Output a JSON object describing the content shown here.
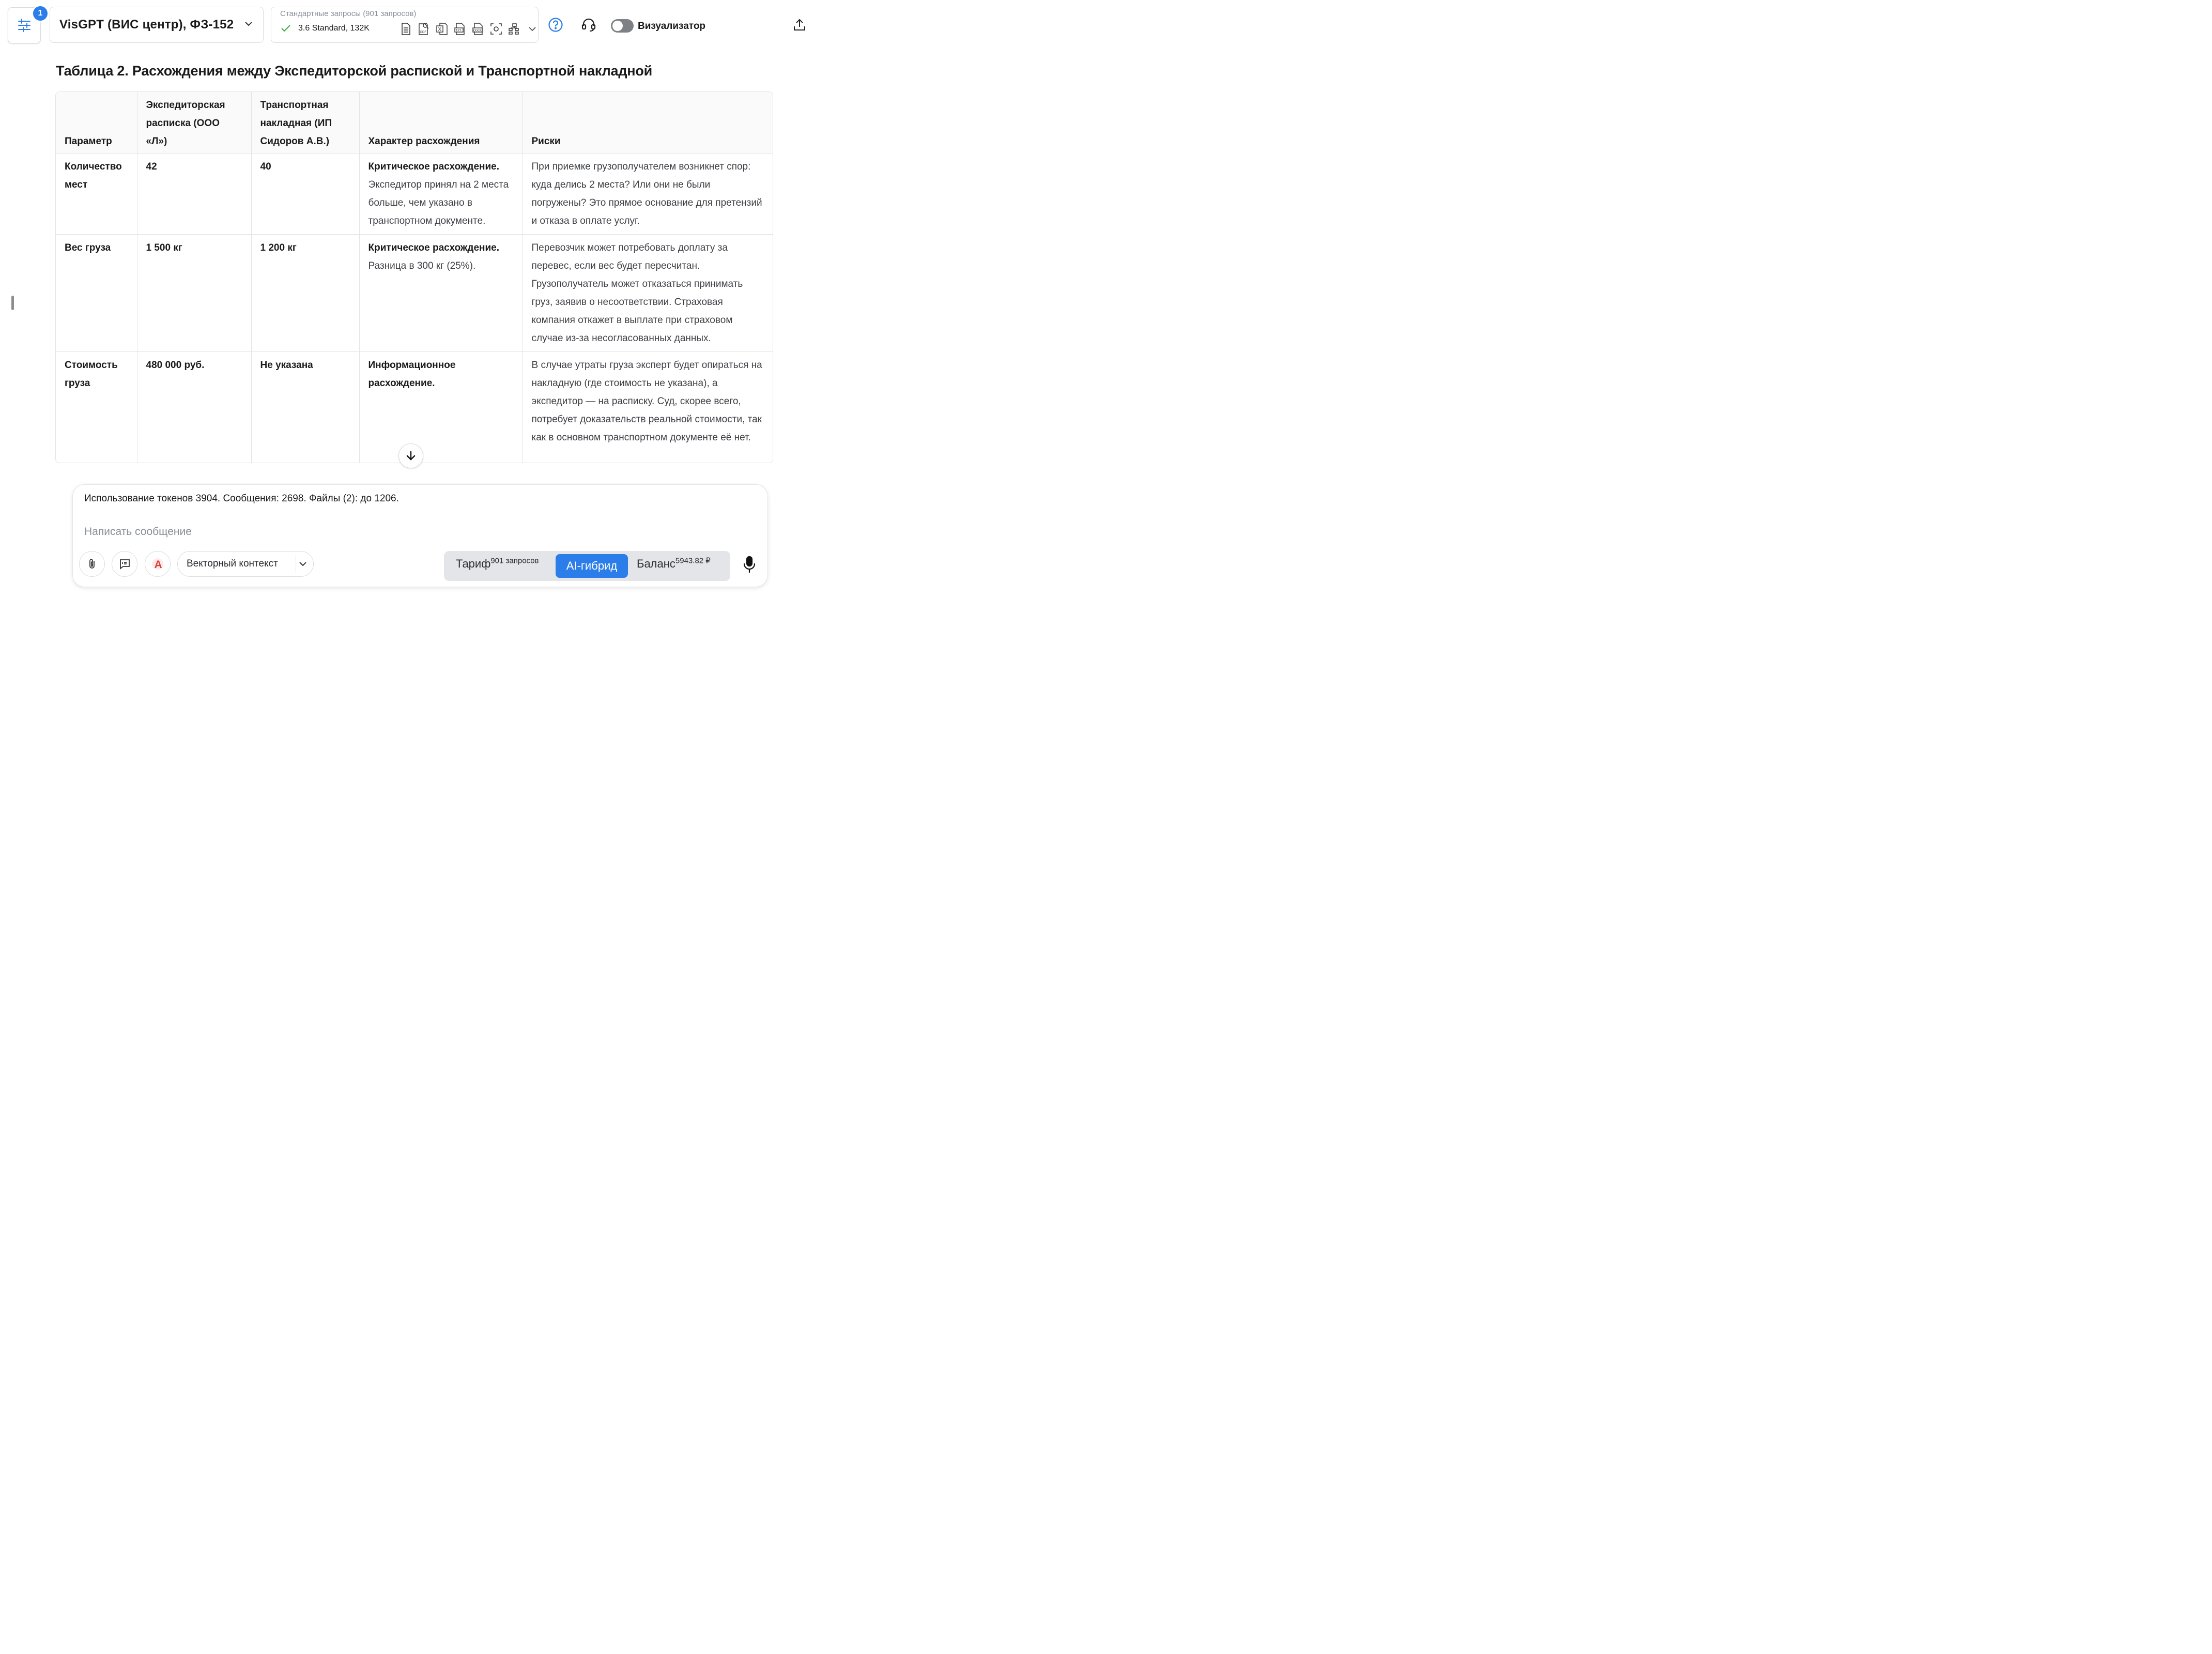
{
  "topbar": {
    "notification_count": "1",
    "model_title": "VisGPT (ВИС центр), ФЗ-152",
    "requests_caption": "Стандартные запросы (901 запросов)",
    "requests_model": "3.6 Standard, 132K",
    "file_icons": [
      "doc-icon",
      "pdf-search-icon",
      "excel-icon",
      "txt-icon",
      "docx-icon",
      "screenshot-icon",
      "diagram-icon"
    ],
    "visualizer_label": "Визуализатор",
    "visualizer_on": false
  },
  "table": {
    "title": "Таблица 2. Расхождения между Экспедиторской распиской и Транспортной накладной",
    "headers": [
      "Параметр",
      "Экспедиторская расписка (ООО «Л»)",
      "Транспортная накладная (ИП Сидоров А.В.)",
      "Характер расхождения",
      "Риски"
    ],
    "rows": [
      {
        "param": "Количество мест",
        "receipt": "42",
        "waybill": "40",
        "nature_bold": "Критическое расхождение.",
        "nature_text": "Экспедитор принял на 2 места больше, чем указано в транспортном документе.",
        "risks": "При приемке грузополучателем возникнет спор: куда делись 2 места? Или они не были погружены? Это прямое основание для претензий и отказа в оплате услуг."
      },
      {
        "param": "Вес груза",
        "receipt": "1 500 кг",
        "waybill": "1 200 кг",
        "nature_bold": "Критическое расхождение.",
        "nature_text": "Разница в 300 кг (25%).",
        "risks": "Перевозчик может потребовать доплату за перевес, если вес будет пересчитан. Грузополучатель может отказаться принимать груз, заявив о несоответствии. Страховая компания откажет в выплате при страховом случае из-за несогласованных данных."
      },
      {
        "param": "Стоимость груза",
        "receipt": "480 000 руб.",
        "waybill": "Не указана",
        "nature_bold": "Информационное расхождение.",
        "nature_text": "",
        "risks": "В случае утраты груза эксперт будет опираться на накладную (где стоимость не указана), а экспедитор — на расписку. Суд, скорее всего, потребует доказательств реальной стоимости, так как в основном транспортном документе её нет."
      }
    ]
  },
  "composer": {
    "usage": "Использование токенов 3904. Сообщения: 2698. Файлы (2): до 1206.",
    "placeholder": "Написать сообщение",
    "vector_context": "Векторный контекст",
    "tariff_label": "Тариф",
    "tariff_value": "901 запросов",
    "hybrid_label": "AI-гибрид",
    "balance_label": "Баланс",
    "balance_value": "5943.82 ₽"
  },
  "colors": {
    "accent": "#2b7de9",
    "check": "#3cb043",
    "toggle_off": "#7d8085",
    "border": "#e2e4e8"
  }
}
